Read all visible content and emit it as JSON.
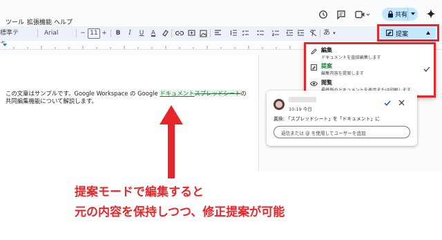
{
  "menubar": {
    "items": [
      "ツール",
      "拡張機能",
      "ヘルプ"
    ],
    "share_label": "共有"
  },
  "toolbar": {
    "style_label": "標準テキ…",
    "font_label": "Arial",
    "font_size": "11",
    "input_tools": "あ",
    "mode_label": "提案"
  },
  "document": {
    "line1_before": "この文章はサンプルです。Google Workspace の Google ",
    "inserted": "ドキュメント",
    "deleted": "スプレッドシート",
    "line1_after": "の",
    "line2": "共同編集機能について解説します。"
  },
  "mode_menu": {
    "options": [
      {
        "title": "編集",
        "desc": "ドキュメントを直接編集します"
      },
      {
        "title": "提案",
        "desc": "編集内容を提案します"
      },
      {
        "title": "閲覧",
        "desc": "最終版のドキュメントを表示または印刷します"
      }
    ]
  },
  "comment": {
    "time": "10:19 今日",
    "body": "置換: 「スプレッドシート」を「ドキュメント」に",
    "reply_placeholder": "返信または @ を使用してユーザーを追加"
  },
  "caption": {
    "line1": "提案モードで編集すると",
    "line2": "元の内容を保持しつつ、修正提案が可能"
  },
  "colors": {
    "accent": "#e8262a",
    "suggest_green": "#188038",
    "share_bg": "#c2e7ff"
  },
  "icons": [
    "history-icon",
    "comment-icon",
    "video-icon",
    "lock-icon",
    "gemini-icon",
    "pencil-icon",
    "suggest-icon",
    "eye-icon",
    "check-icon",
    "close-icon",
    "bold-icon",
    "italic-icon"
  ]
}
